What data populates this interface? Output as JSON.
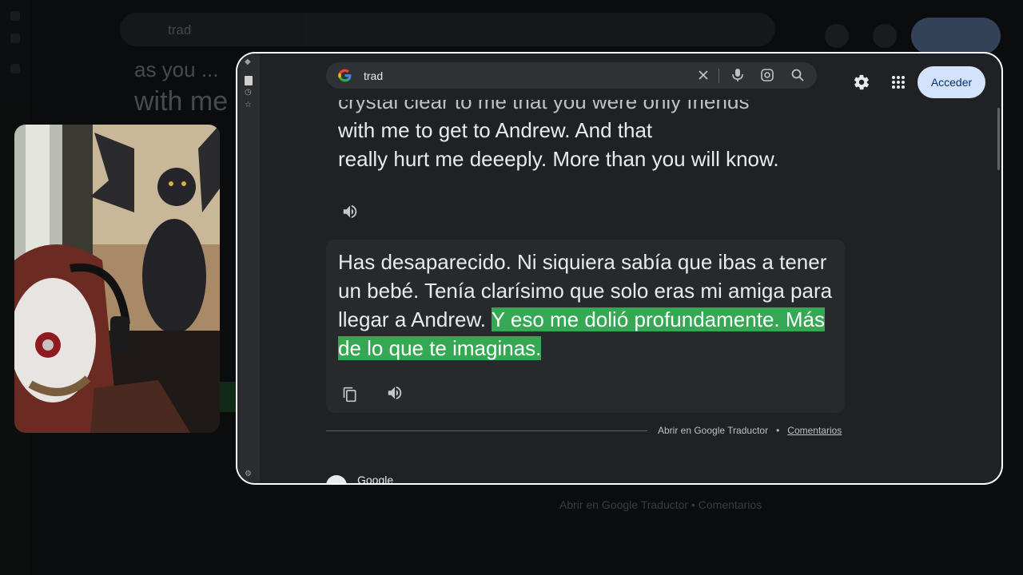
{
  "background": {
    "search_value": "trad",
    "heading_fragment": "with me",
    "heading_fragment_top": "as you ...",
    "footer": "Abrir en Google Traductor  •  Comentarios"
  },
  "search": {
    "value": "trad",
    "icons": [
      "clear-icon",
      "microphone-icon",
      "lens-icon",
      "search-icon"
    ]
  },
  "header": {
    "settings_icon": "gear-icon",
    "apps_icon": "apps-grid-icon",
    "signin_label": "Acceder"
  },
  "source": {
    "lines": [
      "crystal clear to me that you were only friends",
      "with me to get to Andrew. And that",
      "really hurt me deeeply. More than you will know."
    ]
  },
  "translation": {
    "text_plain": "Has desaparecido. Ni siquiera sabía que ibas a tener un bebé. Tenía clarísimo que solo eras mi amiga para llegar a Andrew. ",
    "text_highlighted": "Y eso me dolió profundamente. Más de lo que te imaginas.",
    "highlight_color": "#34a853"
  },
  "footer": {
    "open_link": "Abrir en Google Traductor",
    "separator": "•",
    "feedback_link": "Comentarios"
  },
  "result_source": {
    "name": "Google"
  },
  "colors": {
    "window_bg": "#202124",
    "card_bg": "#28292c",
    "signin_bg": "#d3e3fd",
    "page_bg": "#0b0c0d"
  }
}
